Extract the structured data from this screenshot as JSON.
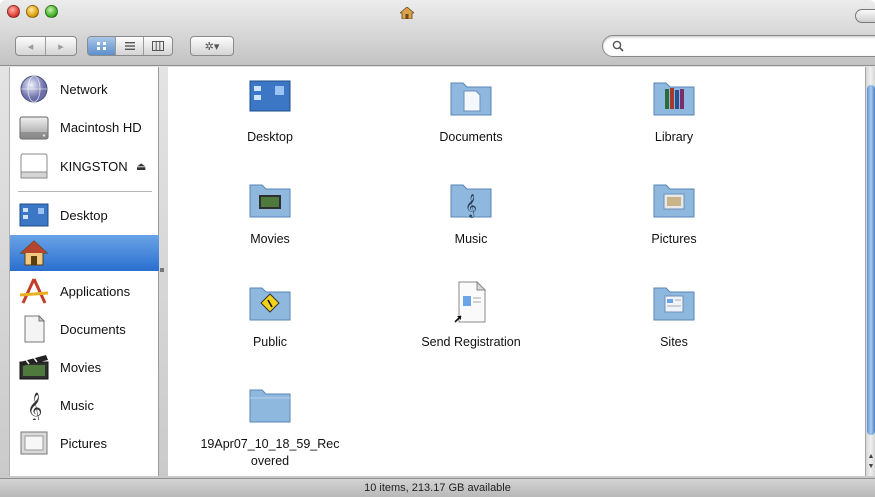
{
  "window": {
    "status": "10 items, 213.17 GB available"
  },
  "toolbar": {
    "back_glyph": "◂",
    "forward_glyph": "▸",
    "action_glyph": "✲▾",
    "search": {
      "placeholder": "",
      "value": ""
    }
  },
  "sidebar": {
    "devices": [
      {
        "label": "Network",
        "icon": "network-globe-icon"
      },
      {
        "label": "Macintosh HD",
        "icon": "hard-drive-icon"
      },
      {
        "label": "KINGSTON",
        "icon": "usb-drive-icon",
        "eject": "⏏"
      }
    ],
    "places": [
      {
        "label": "Desktop",
        "icon": "desktop-folder-icon"
      },
      {
        "label": "",
        "icon": "home-icon",
        "selected": true
      },
      {
        "label": "Applications",
        "icon": "applications-icon"
      },
      {
        "label": "Documents",
        "icon": "document-icon"
      },
      {
        "label": "Movies",
        "icon": "clapperboard-icon"
      },
      {
        "label": "Music",
        "icon": "music-note-icon"
      },
      {
        "label": "Pictures",
        "icon": "picture-frame-icon"
      }
    ]
  },
  "items": [
    {
      "label": "Desktop",
      "icon": "desktop-folder-icon"
    },
    {
      "label": "Documents",
      "icon": "documents-folder-icon"
    },
    {
      "label": "Library",
      "icon": "library-folder-icon"
    },
    {
      "label": "Movies",
      "icon": "movies-folder-icon"
    },
    {
      "label": "Music",
      "icon": "music-folder-icon"
    },
    {
      "label": "Pictures",
      "icon": "pictures-folder-icon"
    },
    {
      "label": "Public",
      "icon": "public-folder-icon"
    },
    {
      "label": "Send Registration",
      "icon": "alias-document-icon"
    },
    {
      "label": "Sites",
      "icon": "sites-folder-icon"
    },
    {
      "label": "19Apr07_10_18_59_Recovered",
      "icon": "plain-folder-icon"
    }
  ],
  "colors": {
    "selection": "#2a6fd0",
    "folder": "#8fb8df"
  }
}
